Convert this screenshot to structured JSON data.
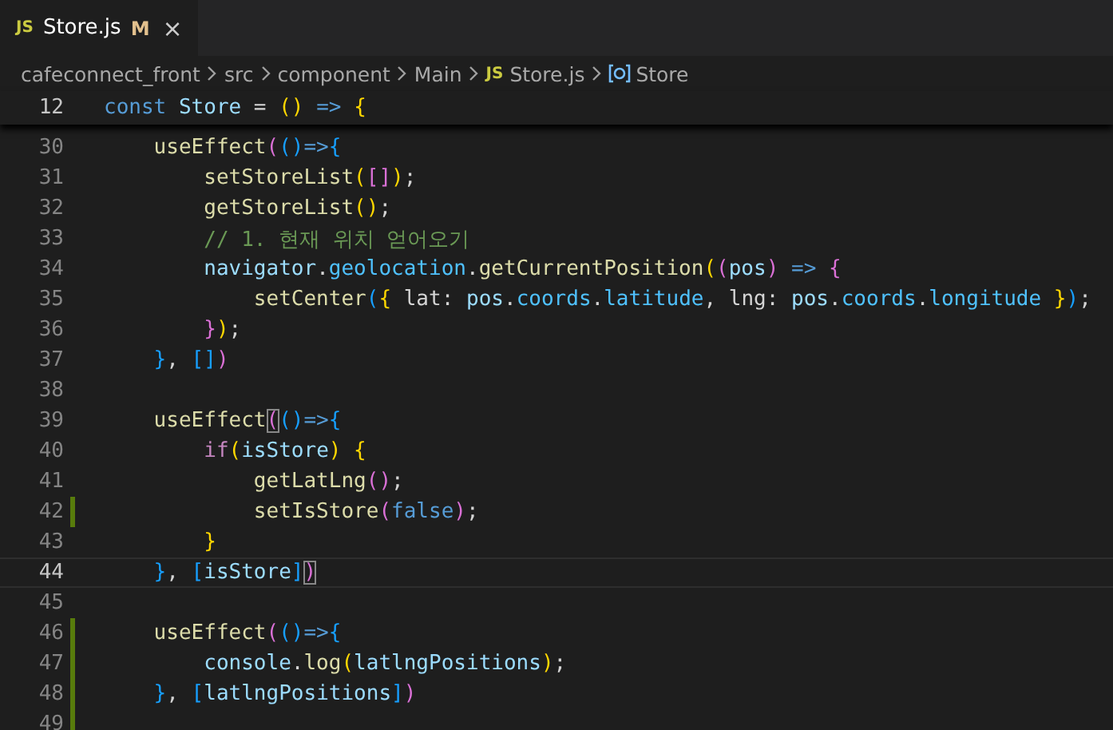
{
  "tabs": [
    {
      "icon_text": "JS",
      "label": "Store.js",
      "status": "M",
      "close": "×",
      "selected": true
    }
  ],
  "breadcrumbs": [
    {
      "label": "cafeconnect_front",
      "kind": "folder"
    },
    {
      "label": "src",
      "kind": "folder"
    },
    {
      "label": "component",
      "kind": "folder"
    },
    {
      "label": "Main",
      "kind": "folder"
    },
    {
      "label": "Store.js",
      "kind": "file",
      "icon_text": "JS"
    },
    {
      "label": "Store",
      "kind": "symbol"
    }
  ],
  "sticky_line": {
    "number": "12",
    "tokens": [
      {
        "t": "const ",
        "kind": "kw"
      },
      {
        "t": "Store",
        "kind": "var"
      },
      {
        "t": " = ",
        "kind": "plain"
      },
      {
        "t": "() ",
        "kind": "b1"
      },
      {
        "t": "=> ",
        "kind": "kw"
      },
      {
        "t": "{",
        "kind": "b1"
      }
    ]
  },
  "lines": [
    {
      "number": "30",
      "modified": false,
      "current": false,
      "tokens": [
        {
          "t": "    useEffect",
          "kind": "fn"
        },
        {
          "t": "(",
          "kind": "b2"
        },
        {
          "t": "()",
          "kind": "b3"
        },
        {
          "t": "=>",
          "kind": "kw"
        },
        {
          "t": "{",
          "kind": "b3"
        }
      ]
    },
    {
      "number": "31",
      "modified": false,
      "current": false,
      "tokens": [
        {
          "t": "        setStoreList",
          "kind": "fn"
        },
        {
          "t": "(",
          "kind": "b1"
        },
        {
          "t": "[]",
          "kind": "b2"
        },
        {
          "t": ")",
          "kind": "b1"
        },
        {
          "t": ";",
          "kind": "plain"
        }
      ]
    },
    {
      "number": "32",
      "modified": false,
      "current": false,
      "tokens": [
        {
          "t": "        getStoreList",
          "kind": "fn"
        },
        {
          "t": "()",
          "kind": "b1"
        },
        {
          "t": ";",
          "kind": "plain"
        }
      ]
    },
    {
      "number": "33",
      "modified": false,
      "current": false,
      "tokens": [
        {
          "t": "        // 1. 현재 위치 얻어오기",
          "kind": "comment"
        }
      ]
    },
    {
      "number": "34",
      "modified": false,
      "current": false,
      "tokens": [
        {
          "t": "        navigator",
          "kind": "var"
        },
        {
          "t": ".",
          "kind": "plain"
        },
        {
          "t": "geolocation",
          "kind": "prop"
        },
        {
          "t": ".",
          "kind": "plain"
        },
        {
          "t": "getCurrentPosition",
          "kind": "fn"
        },
        {
          "t": "(",
          "kind": "b1"
        },
        {
          "t": "(",
          "kind": "b2"
        },
        {
          "t": "pos",
          "kind": "var"
        },
        {
          "t": ") ",
          "kind": "b2"
        },
        {
          "t": "=> ",
          "kind": "kw"
        },
        {
          "t": "{",
          "kind": "b2"
        }
      ]
    },
    {
      "number": "35",
      "modified": false,
      "current": false,
      "tokens": [
        {
          "t": "            setCenter",
          "kind": "fn"
        },
        {
          "t": "(",
          "kind": "b3"
        },
        {
          "t": "{",
          "kind": "b1"
        },
        {
          "t": " lat: ",
          "kind": "plain"
        },
        {
          "t": "pos",
          "kind": "var"
        },
        {
          "t": ".",
          "kind": "plain"
        },
        {
          "t": "coords",
          "kind": "prop"
        },
        {
          "t": ".",
          "kind": "plain"
        },
        {
          "t": "latitude",
          "kind": "prop"
        },
        {
          "t": ", lng: ",
          "kind": "plain"
        },
        {
          "t": "pos",
          "kind": "var"
        },
        {
          "t": ".",
          "kind": "plain"
        },
        {
          "t": "coords",
          "kind": "prop"
        },
        {
          "t": ".",
          "kind": "plain"
        },
        {
          "t": "longitude",
          "kind": "prop"
        },
        {
          "t": " }",
          "kind": "b1"
        },
        {
          "t": ")",
          "kind": "b3"
        },
        {
          "t": ";",
          "kind": "plain"
        }
      ]
    },
    {
      "number": "36",
      "modified": false,
      "current": false,
      "tokens": [
        {
          "t": "        }",
          "kind": "b2"
        },
        {
          "t": ")",
          "kind": "b1"
        },
        {
          "t": ";",
          "kind": "plain"
        }
      ]
    },
    {
      "number": "37",
      "modified": false,
      "current": false,
      "tokens": [
        {
          "t": "    }",
          "kind": "b3"
        },
        {
          "t": ", ",
          "kind": "plain"
        },
        {
          "t": "[]",
          "kind": "b3"
        },
        {
          "t": ")",
          "kind": "b2"
        }
      ]
    },
    {
      "number": "38",
      "modified": false,
      "current": false
    },
    {
      "number": "39",
      "modified": false,
      "current": false,
      "tokens": [
        {
          "t": "    useEffect",
          "kind": "fn"
        },
        {
          "t": "(",
          "kind": "match2"
        },
        {
          "t": "()",
          "kind": "b3"
        },
        {
          "t": "=>",
          "kind": "kw"
        },
        {
          "t": "{",
          "kind": "b3"
        }
      ]
    },
    {
      "number": "40",
      "modified": false,
      "current": false,
      "tokens": [
        {
          "t": "        if",
          "kind": "ctrl"
        },
        {
          "t": "(",
          "kind": "b1"
        },
        {
          "t": "isStore",
          "kind": "var"
        },
        {
          "t": ") {",
          "kind": "b1"
        }
      ]
    },
    {
      "number": "41",
      "modified": false,
      "current": false,
      "tokens": [
        {
          "t": "            getLatLng",
          "kind": "fn"
        },
        {
          "t": "()",
          "kind": "b2"
        },
        {
          "t": ";",
          "kind": "plain"
        }
      ]
    },
    {
      "number": "42",
      "modified": true,
      "current": false,
      "tokens": [
        {
          "t": "            setIsStore",
          "kind": "fn"
        },
        {
          "t": "(",
          "kind": "b2"
        },
        {
          "t": "false",
          "kind": "kw"
        },
        {
          "t": ")",
          "kind": "b2"
        },
        {
          "t": ";",
          "kind": "plain"
        }
      ]
    },
    {
      "number": "43",
      "modified": false,
      "current": false,
      "tokens": [
        {
          "t": "        }",
          "kind": "b1"
        }
      ]
    },
    {
      "number": "44",
      "modified": false,
      "current": true,
      "tokens": [
        {
          "t": "    }",
          "kind": "b3"
        },
        {
          "t": ", ",
          "kind": "plain"
        },
        {
          "t": "[",
          "kind": "b3"
        },
        {
          "t": "isStore",
          "kind": "var"
        },
        {
          "t": "]",
          "kind": "b3"
        },
        {
          "t": ")",
          "kind": "match2"
        }
      ]
    },
    {
      "number": "45",
      "modified": false,
      "current": false
    },
    {
      "number": "46",
      "modified": true,
      "current": false,
      "tokens": [
        {
          "t": "    useEffect",
          "kind": "fn"
        },
        {
          "t": "(",
          "kind": "b2"
        },
        {
          "t": "()",
          "kind": "b3"
        },
        {
          "t": "=>",
          "kind": "kw"
        },
        {
          "t": "{",
          "kind": "b3"
        }
      ]
    },
    {
      "number": "47",
      "modified": true,
      "current": false,
      "tokens": [
        {
          "t": "        console",
          "kind": "var"
        },
        {
          "t": ".",
          "kind": "plain"
        },
        {
          "t": "log",
          "kind": "fn"
        },
        {
          "t": "(",
          "kind": "b1"
        },
        {
          "t": "latlngPositions",
          "kind": "var"
        },
        {
          "t": ")",
          "kind": "b1"
        },
        {
          "t": ";",
          "kind": "plain"
        }
      ]
    },
    {
      "number": "48",
      "modified": true,
      "current": false,
      "tokens": [
        {
          "t": "    }",
          "kind": "b3"
        },
        {
          "t": ", ",
          "kind": "plain"
        },
        {
          "t": "[",
          "kind": "b3"
        },
        {
          "t": "latlngPositions",
          "kind": "var"
        },
        {
          "t": "]",
          "kind": "b3"
        },
        {
          "t": ")",
          "kind": "b2"
        }
      ]
    },
    {
      "number": "49",
      "modified": true,
      "current": false
    }
  ]
}
